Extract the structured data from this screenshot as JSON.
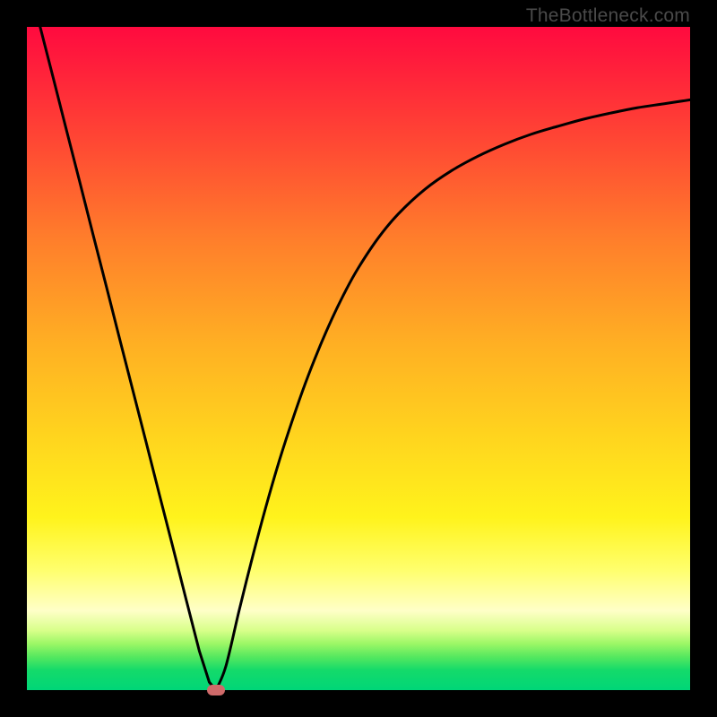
{
  "watermark": "TheBottleneck.com",
  "chart_data": {
    "type": "line",
    "title": "",
    "xlabel": "",
    "ylabel": "",
    "xlim": [
      0,
      100
    ],
    "ylim": [
      0,
      100
    ],
    "series": [
      {
        "name": "left-branch",
        "x": [
          2,
          4,
          6,
          8,
          10,
          12,
          14,
          16,
          18,
          20,
          22,
          24,
          26,
          27.5,
          28.5
        ],
        "values": [
          100,
          92.2,
          84.3,
          76.5,
          68.6,
          60.8,
          52.9,
          45.1,
          37.3,
          29.4,
          21.6,
          13.7,
          5.9,
          1.2,
          0
        ]
      },
      {
        "name": "right-branch",
        "x": [
          28.5,
          30,
          32,
          34,
          36,
          38,
          40,
          42,
          44,
          46,
          48,
          50,
          53,
          56,
          60,
          64,
          68,
          72,
          76,
          80,
          84,
          88,
          92,
          96,
          100
        ],
        "values": [
          0,
          3.6,
          12.0,
          20.0,
          27.5,
          34.4,
          40.6,
          46.3,
          51.4,
          56.0,
          60.1,
          63.7,
          68.2,
          71.8,
          75.5,
          78.3,
          80.5,
          82.3,
          83.8,
          85.0,
          86.1,
          87.0,
          87.8,
          88.4,
          89.0
        ]
      }
    ],
    "marker": {
      "x": 28.5,
      "y": 0
    },
    "grid": false,
    "legend": null
  },
  "colors": {
    "curve": "#000000",
    "marker": "#cf6a6a",
    "frame_bg_top": "#ff0a3f",
    "frame_bg_bottom": "#00d678",
    "page_bg": "#000000"
  }
}
